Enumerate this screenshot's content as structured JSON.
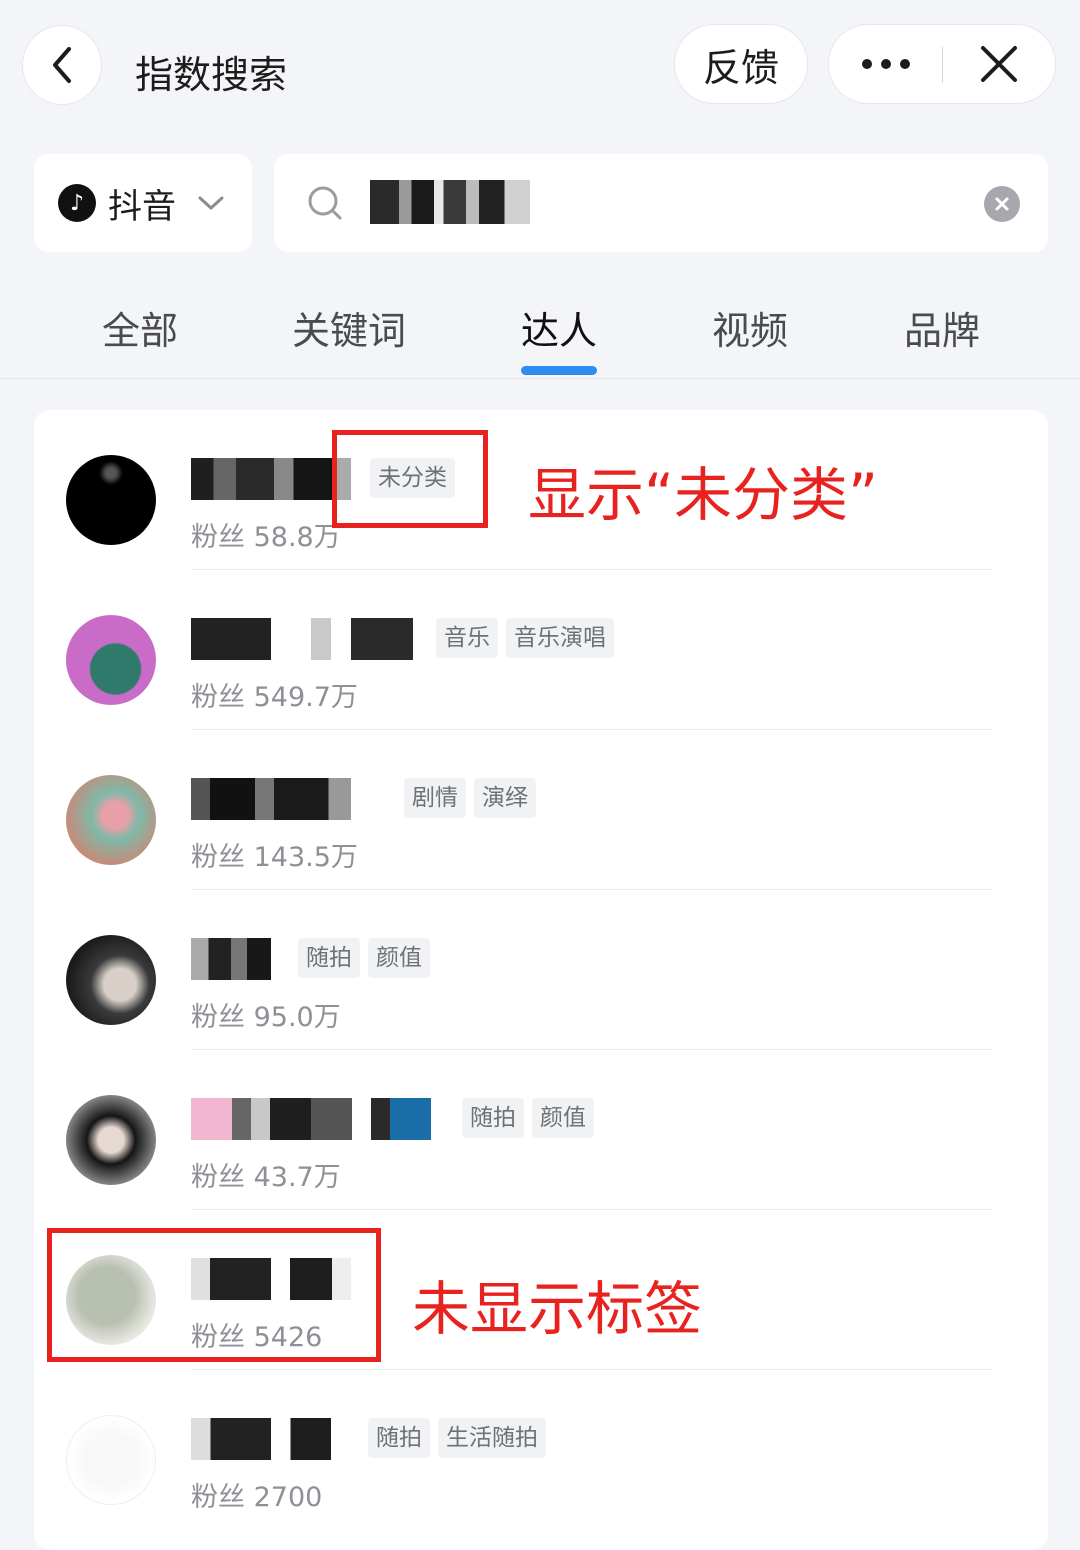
{
  "header": {
    "title": "指数搜索",
    "feedback_label": "反馈"
  },
  "search": {
    "platform": "抖音",
    "query": "(mosaic-blurred text)"
  },
  "tabs": [
    {
      "label": "全部"
    },
    {
      "label": "关键词"
    },
    {
      "label": "达人"
    },
    {
      "label": "视频"
    },
    {
      "label": "品牌"
    }
  ],
  "active_tab": "达人",
  "creators": [
    {
      "fans": "粉丝 58.8万",
      "tags": [
        "未分类"
      ]
    },
    {
      "fans": "粉丝 549.7万",
      "tags": [
        "音乐",
        "音乐演唱"
      ]
    },
    {
      "fans": "粉丝 143.5万",
      "tags": [
        "剧情",
        "演绎"
      ]
    },
    {
      "fans": "粉丝 95.0万",
      "tags": [
        "随拍",
        "颜值"
      ]
    },
    {
      "fans": "粉丝 43.7万",
      "tags": [
        "随拍",
        "颜值"
      ]
    },
    {
      "fans": "粉丝 5426",
      "tags": []
    },
    {
      "fans": "粉丝 2700",
      "tags": [
        "随拍",
        "生活随拍"
      ]
    }
  ],
  "annotations": {
    "uncategorized": "显示“未分类”",
    "no_tag": "未显示标签"
  },
  "colors": {
    "accent": "#2f8cf5",
    "annotation": "#e8231f"
  }
}
